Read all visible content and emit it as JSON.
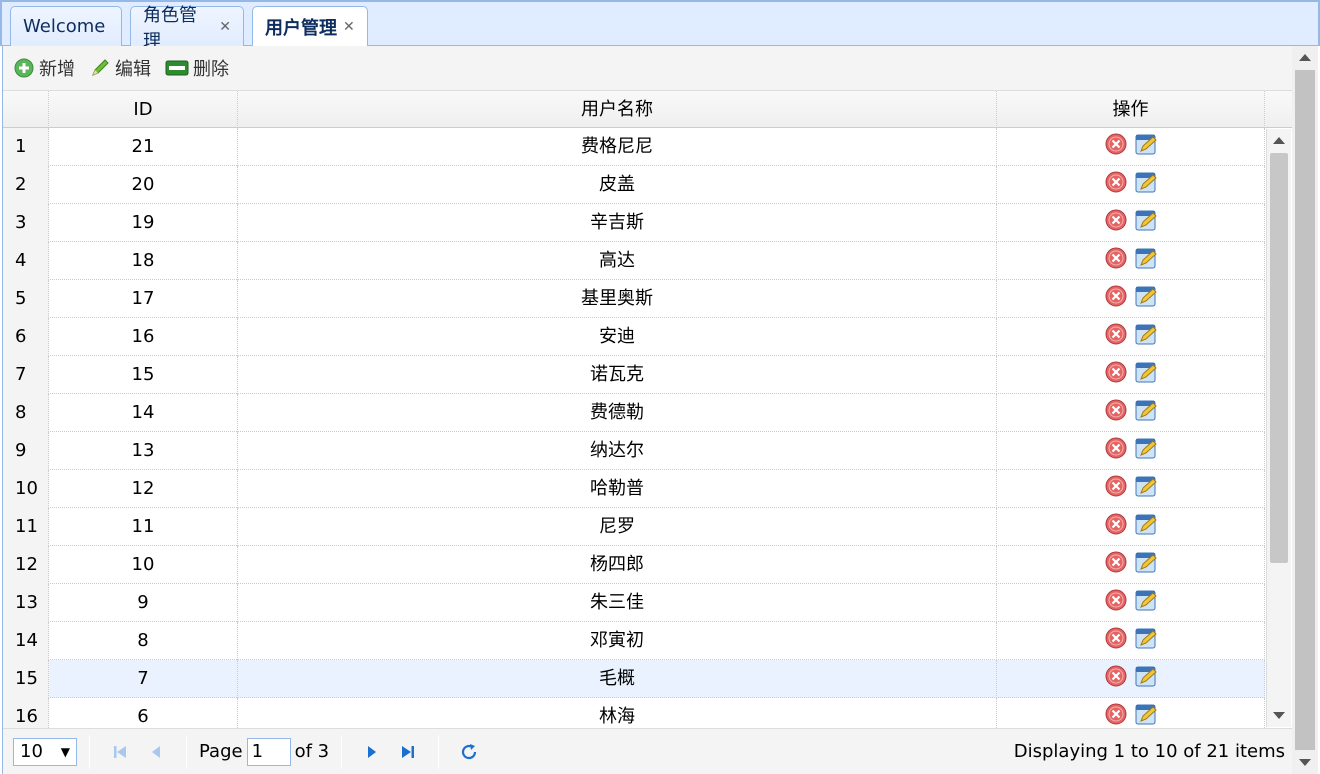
{
  "tabs": [
    {
      "label": "Welcome",
      "closable": false,
      "active": false
    },
    {
      "label": "角色管理",
      "closable": true,
      "active": false
    },
    {
      "label": "用户管理",
      "closable": true,
      "active": true
    }
  ],
  "toolbar": {
    "add_label": "新增",
    "edit_label": "编辑",
    "delete_label": "删除"
  },
  "grid": {
    "columns": [
      "ID",
      "用户名称",
      "操作"
    ],
    "rows": [
      {
        "num": "1",
        "id": "21",
        "name": "费格尼尼"
      },
      {
        "num": "2",
        "id": "20",
        "name": "皮盖"
      },
      {
        "num": "3",
        "id": "19",
        "name": "辛吉斯"
      },
      {
        "num": "4",
        "id": "18",
        "name": "高达"
      },
      {
        "num": "5",
        "id": "17",
        "name": "基里奥斯"
      },
      {
        "num": "6",
        "id": "16",
        "name": "安迪"
      },
      {
        "num": "7",
        "id": "15",
        "name": "诺瓦克"
      },
      {
        "num": "8",
        "id": "14",
        "name": "费德勒"
      },
      {
        "num": "9",
        "id": "13",
        "name": "纳达尔"
      },
      {
        "num": "10",
        "id": "12",
        "name": "哈勒普"
      },
      {
        "num": "11",
        "id": "11",
        "name": "尼罗"
      },
      {
        "num": "12",
        "id": "10",
        "name": "杨四郎"
      },
      {
        "num": "13",
        "id": "9",
        "name": "朱三佳"
      },
      {
        "num": "14",
        "id": "8",
        "name": "邓寅初"
      },
      {
        "num": "15",
        "id": "7",
        "name": "毛概"
      },
      {
        "num": "16",
        "id": "6",
        "name": "林海"
      }
    ],
    "highlight_row": "15"
  },
  "pager": {
    "page_size": "10",
    "page_label": "Page",
    "page_value": "1",
    "of_label": "of 3",
    "info": "Displaying 1 to 10 of 21 items"
  },
  "colors": {
    "border": "#95b8e7",
    "tab_bg": "#e0ecff",
    "highlight": "#eaf2ff",
    "delete_red": "#e05050",
    "add_green": "#5bb55b"
  }
}
